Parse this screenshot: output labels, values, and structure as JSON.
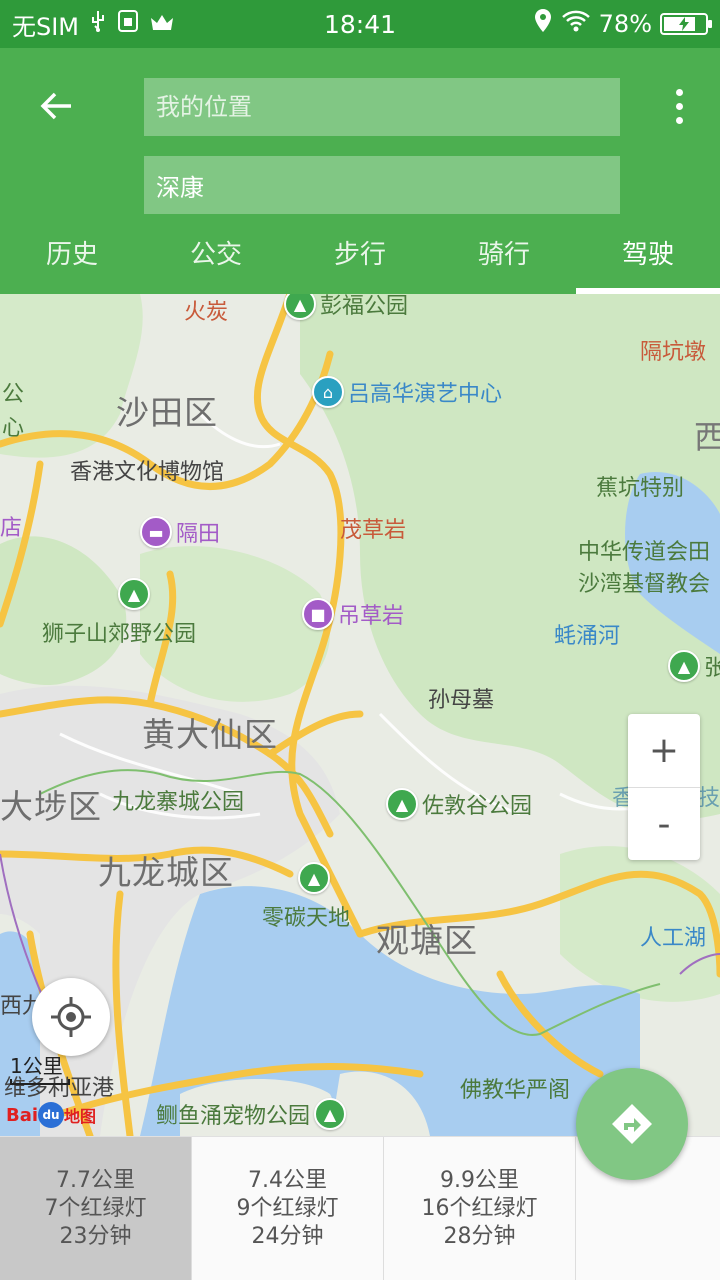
{
  "status_bar": {
    "carrier": "无SIM",
    "time": "18:41",
    "battery_text": "78%",
    "battery_level": 0.78,
    "icons": [
      "usb-icon",
      "sim-icon",
      "crown-icon",
      "location-icon",
      "wifi-icon",
      "battery-icon"
    ]
  },
  "header": {
    "origin_placeholder": "我的位置",
    "destination_value": "深康",
    "tabs": [
      {
        "label": "历史"
      },
      {
        "label": "公交"
      },
      {
        "label": "步行"
      },
      {
        "label": "骑行"
      },
      {
        "label": "驾驶",
        "active": true
      }
    ],
    "colors": {
      "primary": "#4caf50",
      "status": "#2f9a3a",
      "input": "#81c784"
    }
  },
  "map": {
    "districts": [
      "沙田区",
      "黄大仙区",
      "九龙城区",
      "观塘区",
      "大埗区"
    ],
    "labels": {
      "huotan": "火炭",
      "pengfu_park": "彭福公园",
      "geong_kan": "隔坑墩",
      "sai": "西",
      "gong": "公",
      "xin": "心",
      "museum": "香港文化博物馆",
      "lu_gao_hua": "吕高华演艺中心",
      "jiaokeng": "蕉坑特别",
      "maocaoyan": "茂草岩",
      "dian": "店",
      "zhonghua": "中华传道会田",
      "shawan": "沙湾基督教会",
      "geyong": "蚝涌河",
      "diaocaoyan": "吊草岩",
      "sunmu": "孙母墓",
      "shizi_park": "狮子山郊野公园",
      "jiulong_park": "九龙寨城公园",
      "zuodun_park": "佐敦谷公园",
      "lingtan": "零碳天地",
      "rengong": "人工湖",
      "fojiao": "佛教华严阁",
      "wei": "维多利亚港",
      "xi": "西九",
      "yu_park": "鲗鱼涌宠物公园",
      "zhang": "张",
      "xiang": "香",
      "ji": "技",
      "geti": "隔田"
    },
    "zoom_in": "+",
    "zoom_out": "-",
    "scale": "1公里",
    "logo": {
      "baidu": "Bai",
      "du": "du",
      "suffix": "地图"
    }
  },
  "routes": [
    {
      "distance": "7.7公里",
      "lights": "7个红绿灯",
      "time": "23分钟",
      "selected": true
    },
    {
      "distance": "7.4公里",
      "lights": "9个红绿灯",
      "time": "24分钟"
    },
    {
      "distance": "9.9公里",
      "lights": "16个红绿灯",
      "time": "28分钟"
    }
  ]
}
